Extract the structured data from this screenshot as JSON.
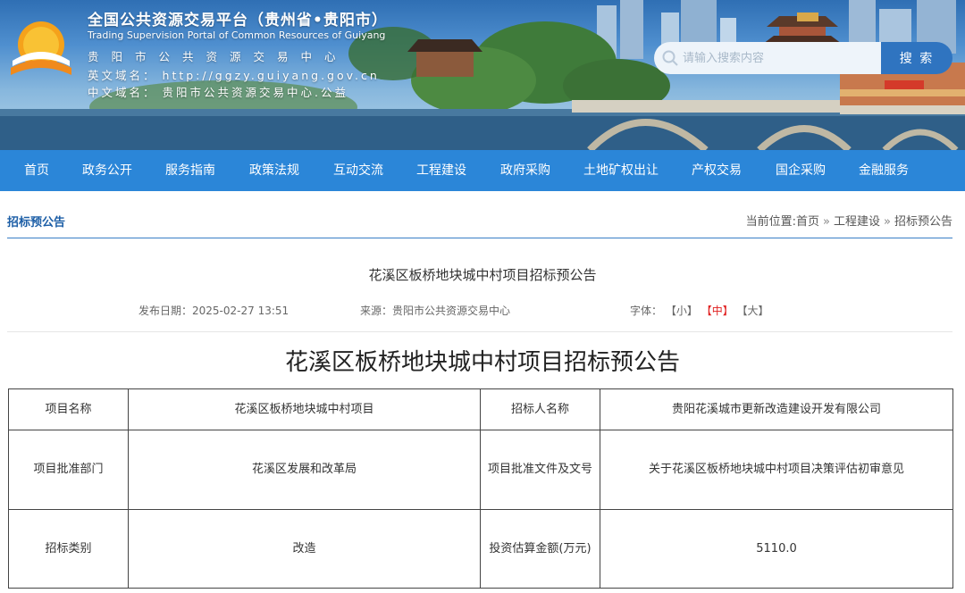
{
  "header": {
    "site_name": "全国公共资源交易平台（贵州省•贵阳市）",
    "site_name_en": "Trading Supervision Portal of Common Resources of Guiyang",
    "center_name": "贵阳市公共资源交易中心",
    "en_domain_label": "英文域名：",
    "en_domain": "http://ggzy.guiyang.gov.cn",
    "cn_domain_label": "中文域名：",
    "cn_domain": "贵阳市公共资源交易中心.公益",
    "search_placeholder": "请输入搜索内容",
    "search_button": "搜 索"
  },
  "nav": [
    "首页",
    "政务公开",
    "服务指南",
    "政策法规",
    "互动交流",
    "工程建设",
    "政府采购",
    "土地矿权出让",
    "产权交易",
    "国企采购",
    "金融服务"
  ],
  "location": {
    "section_title": "招标预公告",
    "prefix": "当前位置:",
    "crumbs": [
      "首页",
      "工程建设",
      "招标预公告"
    ],
    "separator": "»"
  },
  "article": {
    "title": "花溪区板桥地块城中村项目招标预公告",
    "date_label": "发布日期：",
    "date": "2025-02-27 13:51",
    "source_label": "来源：",
    "source": "贵阳市公共资源交易中心",
    "font_label": "字体：",
    "font_small": "【小】",
    "font_medium": "【中】",
    "font_large": "【大】",
    "heading": "花溪区板桥地块城中村项目招标预公告"
  },
  "table": {
    "rows": [
      [
        "项目名称",
        "花溪区板桥地块城中村项目",
        "招标人名称",
        "贵阳花溪城市更新改造建设开发有限公司"
      ],
      [
        "项目批准部门",
        "花溪区发展和改革局",
        "项目批准文件及文号",
        "关于花溪区板桥地块城中村项目决策评估初审意见"
      ],
      [
        "招标类别",
        "改造",
        "投资估算金额(万元)",
        "5110.0"
      ]
    ]
  },
  "colors": {
    "nav_bg": "#2b86d8",
    "accent": "#1c5ea6",
    "active_font": "#e02020"
  }
}
